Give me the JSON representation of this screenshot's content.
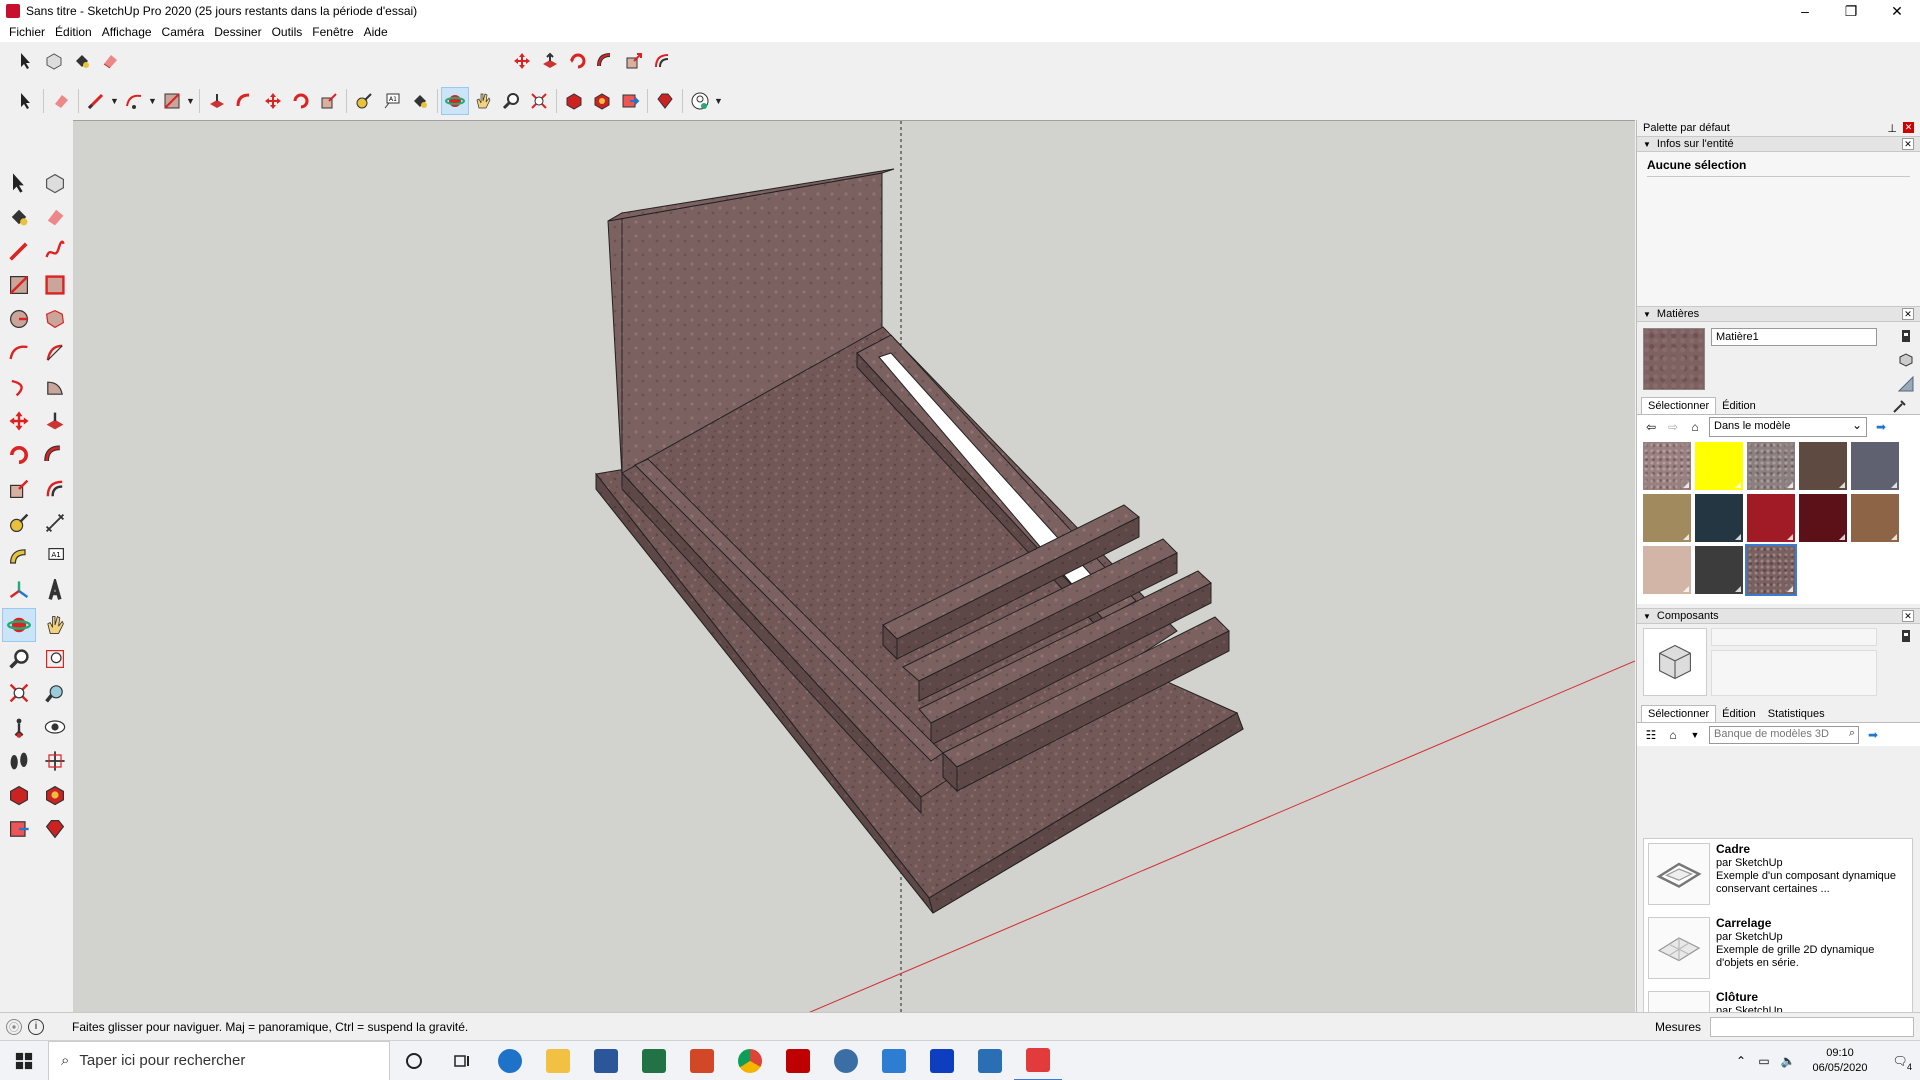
{
  "window": {
    "title": "Sans titre - SketchUp Pro 2020 (25 jours restants dans la période d'essai)",
    "controls": [
      "–",
      "❐",
      "✕"
    ]
  },
  "menu": [
    "Fichier",
    "Édition",
    "Affichage",
    "Caméra",
    "Dessiner",
    "Outils",
    "Fenêtre",
    "Aide"
  ],
  "tray": {
    "title": "Palette par défaut",
    "entity_info": {
      "header": "Infos sur l'entité",
      "value": "Aucune sélection"
    },
    "materials": {
      "header": "Matières",
      "name": "Matière1",
      "tabs": [
        "Sélectionner",
        "Édition"
      ],
      "collection": "Dans le modèle",
      "swatches": [
        {
          "color": "#9a8080",
          "texture": true
        },
        {
          "color": "#ffff00",
          "texture": false
        },
        {
          "color": "#8e7f7f",
          "texture": true
        },
        {
          "color": "#5e4a40",
          "texture": false
        },
        {
          "color": "#5f6170",
          "texture": false
        },
        {
          "color": "#a08a5e",
          "texture": false
        },
        {
          "color": "#243641",
          "texture": false
        },
        {
          "color": "#a01b26",
          "texture": false
        },
        {
          "color": "#5c1018",
          "texture": false
        },
        {
          "color": "#8e6446",
          "texture": false
        },
        {
          "color": "#d3b5a8",
          "texture": false
        },
        {
          "color": "#3c3c3c",
          "texture": false
        },
        {
          "color": "#7b6060",
          "texture": true,
          "selected": true
        }
      ]
    },
    "components": {
      "header": "Composants",
      "tabs": [
        "Sélectionner",
        "Édition",
        "Statistiques"
      ],
      "search_placeholder": "Banque de modèles 3D",
      "items": [
        {
          "name": "Cadre",
          "author": "par SketchUp",
          "desc": "Exemple d'un composant dynamique conservant certaines ..."
        },
        {
          "name": "Carrelage",
          "author": "par SketchUp",
          "desc": "Exemple de grille 2D dynamique d'objets en série."
        },
        {
          "name": "Clôture",
          "author": "par SketchUp",
          "desc": ""
        }
      ]
    }
  },
  "status": {
    "message": "Faites glisser pour naviguer. Maj = panoramique, Ctrl =  suspend la gravité.",
    "measures_label": "Mesures",
    "info_icon": "i"
  },
  "taskbar": {
    "search_placeholder": "Taper ici pour rechercher",
    "time": "09:10",
    "date": "06/05/2020",
    "notif_count": "4"
  },
  "colors": {
    "viewport": "#d2d2ce",
    "stone": "#6f5555",
    "accent": "#3a7bd5"
  }
}
